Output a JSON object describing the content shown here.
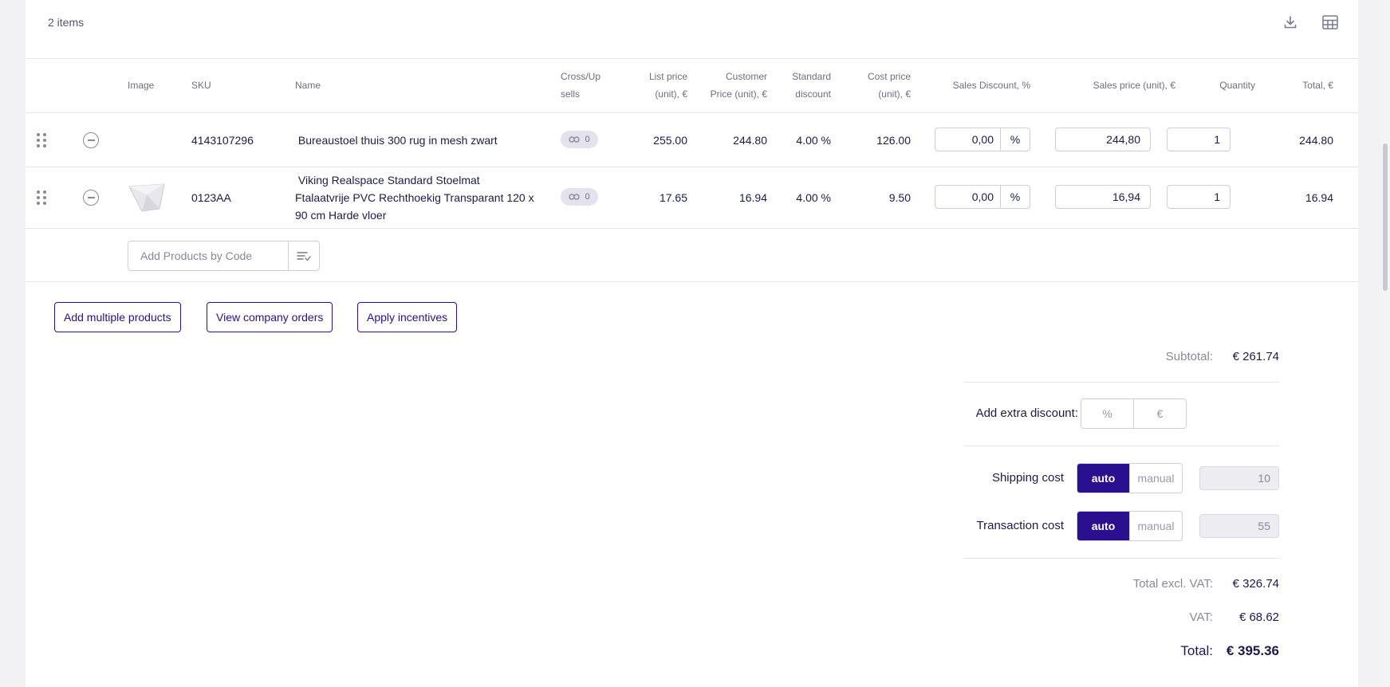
{
  "header": {
    "items_count": "2 items"
  },
  "icons": {
    "download": "download-icon",
    "columns": "table-columns-icon"
  },
  "columns": {
    "image": "Image",
    "sku": "SKU",
    "name": "Name",
    "cross_up_1": "Cross/Up",
    "cross_up_2": "sells",
    "list_price_1": "List price",
    "list_price_2": "(unit), €",
    "customer_price_1": "Customer",
    "customer_price_2": "Price (unit), €",
    "standard_discount_1": "Standard",
    "standard_discount_2": "discount",
    "cost_price_1": "Cost price",
    "cost_price_2": "(unit), €",
    "sales_discount": "Sales Discount, %",
    "sales_price": "Sales price (unit), €",
    "quantity": "Quantity",
    "total": "Total, €"
  },
  "rows": [
    {
      "sku": "4143107296",
      "name_1": " Bureaustoel thuis 300 rug in mesh zwart",
      "name_2": "",
      "name_3": "",
      "cross_count": "0",
      "list_price": "255.00",
      "customer_price": "244.80",
      "standard_discount": "4.00 %",
      "cost_price": "126.00",
      "sales_discount": "0,00",
      "sales_discount_unit": "%",
      "sales_price": "244,80",
      "quantity": "1",
      "total": "244.80"
    },
    {
      "sku": "0123AA",
      "name_1": " Viking Realspace Standard Stoelmat",
      "name_2": "Ftalaatvrije PVC Rechthoekig Transparant 120 x",
      "name_3": "90 cm Harde vloer",
      "cross_count": "0",
      "list_price": "17.65",
      "customer_price": "16.94",
      "standard_discount": "4.00 %",
      "cost_price": "9.50",
      "sales_discount": "0,00",
      "sales_discount_unit": "%",
      "sales_price": "16,94",
      "quantity": "1",
      "total": "16.94"
    }
  ],
  "add_by_code": {
    "placeholder": "Add Products by Code"
  },
  "actions": {
    "add_multiple": "Add multiple products",
    "view_orders": "View company orders",
    "apply_incentives": "Apply incentives"
  },
  "summary": {
    "subtotal_label": "Subtotal:",
    "subtotal_value": "€ 261.74",
    "extra_discount_label": "Add extra discount:",
    "extra_discount_percent": "%",
    "extra_discount_euro": "€",
    "shipping_label": "Shipping cost",
    "shipping_auto": "auto",
    "shipping_manual": "manual",
    "shipping_value": "10",
    "transaction_label": "Transaction cost",
    "transaction_auto": "auto",
    "transaction_manual": "manual",
    "transaction_value": "55",
    "excl_vat_label": "Total excl. VAT:",
    "excl_vat_value": "€ 326.74",
    "vat_label": "VAT:",
    "vat_value": "€ 68.62",
    "total_label": "Total:",
    "total_value": "€ 395.36"
  },
  "colors": {
    "accent": "#2a0f8f",
    "text": "#1e1a4a",
    "muted": "#8a889a"
  }
}
